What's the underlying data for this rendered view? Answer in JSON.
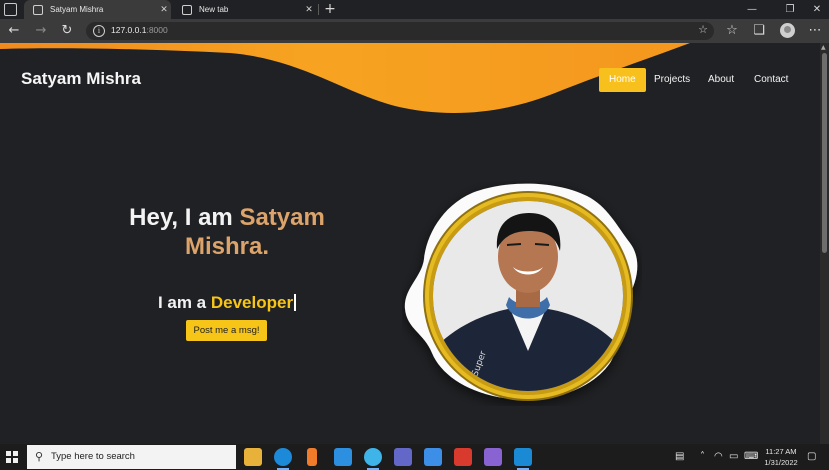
{
  "browser": {
    "tabs": [
      {
        "title": "Satyam Mishra",
        "active": true
      },
      {
        "title": "New tab",
        "active": false
      }
    ],
    "new_tab_icon": "plus-icon",
    "url_host": "127.0.0.1",
    "url_port": ":8000",
    "window_controls": [
      "minimize-icon",
      "restore-icon",
      "close-icon"
    ]
  },
  "site": {
    "brand": "Satyam Mishra",
    "nav": [
      {
        "label": "Home",
        "active": true
      },
      {
        "label": "Projects",
        "active": false
      },
      {
        "label": "About",
        "active": false
      },
      {
        "label": "Contact",
        "active": false
      }
    ],
    "hero": {
      "greeting": "Hey, I am ",
      "name": "Satyam Mishra.",
      "sub_prefix": "I am a ",
      "sub_role": "Developer",
      "cta": "Post me a msg!"
    },
    "colors": {
      "accent": "#f8c01c",
      "wave": "#f7a321",
      "name": "#dca46a",
      "background": "#202124"
    }
  },
  "taskbar": {
    "search_placeholder": "Type here to search",
    "time": "11:27 AM",
    "date": "1/31/2022"
  }
}
